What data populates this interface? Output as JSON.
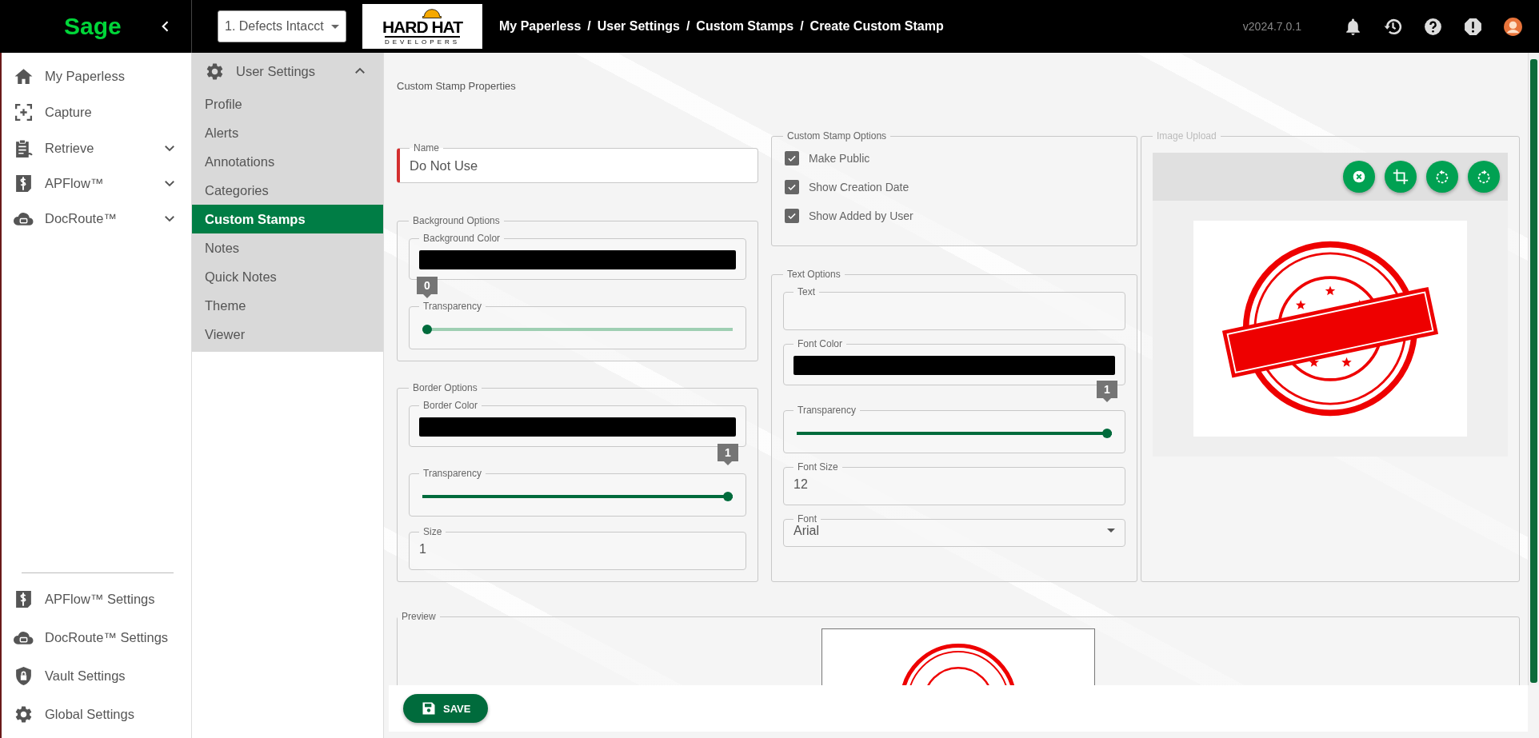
{
  "topbar": {
    "logo": "Sage",
    "company_select": {
      "value": "1. Defects Intacct"
    },
    "brand_logo": {
      "title": "HARD HAT",
      "subtitle": "DEVELOPERS"
    },
    "breadcrumb": [
      {
        "label": "My Paperless"
      },
      {
        "separator": "/",
        "label": "User Settings"
      },
      {
        "separator": "/",
        "label": "Custom Stamps"
      },
      {
        "separator": "/",
        "label": "Create Custom Stamp"
      }
    ],
    "version": "v2024.7.0.1"
  },
  "nav": {
    "items": [
      {
        "label": "My Paperless",
        "kind": "link"
      },
      {
        "label": "Capture",
        "kind": "link"
      },
      {
        "label": "Retrieve",
        "kind": "group",
        "expanded": false
      },
      {
        "label": "APFlow™",
        "kind": "group",
        "expanded": false
      },
      {
        "label": "DocRoute™",
        "kind": "group",
        "expanded": false
      }
    ],
    "bottom_items": [
      {
        "label": "APFlow™ Settings"
      },
      {
        "label": "DocRoute™ Settings"
      },
      {
        "label": "Vault Settings"
      },
      {
        "label": "Global Settings"
      }
    ]
  },
  "subnav": {
    "title": "User Settings",
    "expanded": true,
    "items": [
      {
        "label": "Profile",
        "selected": false
      },
      {
        "label": "Alerts",
        "selected": false
      },
      {
        "label": "Annotations",
        "selected": false
      },
      {
        "label": "Categories",
        "selected": false
      },
      {
        "label": "Custom Stamps",
        "selected": true
      },
      {
        "label": "Notes",
        "selected": false
      },
      {
        "label": "Quick Notes",
        "selected": false
      },
      {
        "label": "Theme",
        "selected": false
      },
      {
        "label": "Viewer",
        "selected": false
      }
    ]
  },
  "page_title": "Custom Stamp Properties",
  "name_field": {
    "label": "Name",
    "value": "Do Not Use",
    "required": true
  },
  "background_options": {
    "legend": "Background Options",
    "color_field": {
      "label": "Background Color",
      "color": "#000000"
    },
    "transparency": {
      "label": "Transparency",
      "level": 0,
      "reading": "0"
    }
  },
  "border_options": {
    "legend": "Border Options",
    "color_field": {
      "label": "Border Color",
      "color": "#000000"
    },
    "transparency": {
      "label": "Transparency",
      "level": 1,
      "reading": "1"
    },
    "size_field": {
      "label": "Size",
      "value": "1"
    }
  },
  "stamp_options": {
    "legend": "Custom Stamp Options",
    "checkboxes": [
      {
        "label": "Make Public",
        "checked": true
      },
      {
        "label": "Show Creation Date",
        "checked": true
      },
      {
        "label": "Show Added by User",
        "checked": true
      }
    ]
  },
  "text_options": {
    "legend": "Text Options",
    "text_field": {
      "label": "Text"
    },
    "font_color": {
      "label": "Font Color",
      "color": "#000000"
    },
    "transparency": {
      "label": "Transparency",
      "level": 1,
      "reading": "1"
    },
    "font_size": {
      "label": "Font Size",
      "value": "12"
    },
    "font": {
      "label": "Font",
      "value": "Arial"
    }
  },
  "image_upload": {
    "legend": "Image Upload"
  },
  "preview": {
    "legend": "Preview"
  },
  "save_button": {
    "label": "SAVE"
  }
}
